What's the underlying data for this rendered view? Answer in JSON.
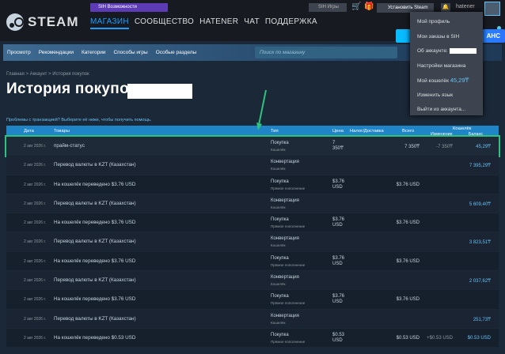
{
  "header": {
    "logo_text": "STEAM",
    "sih_badge": "SIH Возможности",
    "nav": [
      "МАГАЗИН",
      "СООБЩЕСТВО",
      "HATENER",
      "ЧАТ",
      "ПОДДЕРЖКА"
    ],
    "sih_games": "SIH Игры",
    "install_label": "Установить Steam",
    "username": "hatener",
    "promo_label": "АНС"
  },
  "dropdown": {
    "items": [
      "Мой профиль",
      "Мои заказы в SIH",
      "Об аккаунте:",
      "Настройки магазина"
    ],
    "wallet_label": "Мой кошелёк",
    "wallet_amount": "45,29₸",
    "language": "Изменить язык",
    "logout": "Выйти из аккаунта..."
  },
  "subnav": {
    "items": [
      "Просмотр",
      "Рекомендации",
      "Категории",
      "Способы игры",
      "Особые разделы"
    ],
    "search_placeholder": "Поиск по магазину"
  },
  "breadcrumb": "Главная > Аккаунт > История покупок",
  "page_title": "История покупок",
  "help_text": "Проблемы с транзакцией? Выберите её ниже, чтобы получить помощь.",
  "table": {
    "headers": {
      "date": "Дата",
      "items": "Товары",
      "type": "Тип",
      "price": "Цена",
      "tax": "Налог/Доставка",
      "total": "Всего",
      "wallet": "Кошелёк",
      "change": "Изменение",
      "balance": "Баланс"
    },
    "rows": [
      {
        "date": "2 авг 2026 г.",
        "items": "прайм-статус",
        "type": "Покупка",
        "sub": "Кошелёк",
        "price1": "7",
        "price2": "350₸",
        "total": "7 350₸",
        "change": "-7 350₸",
        "balance": "45,29₸"
      },
      {
        "date": "2 авг 2026 г.",
        "items": "Перевод валюты в KZT (Казахстан)",
        "type": "Конвертация",
        "sub": "Кошелёк",
        "price1": "",
        "price2": "",
        "total": "",
        "change": "",
        "balance": "7 395,29₸"
      },
      {
        "date": "2 авг 2026 г.",
        "items": "На кошелёк переведено $3.76 USD",
        "type": "Покупка",
        "sub": "Прямое пополнение",
        "price1": "$3.76",
        "price2": "USD",
        "total": "$3.76 USD",
        "change": "",
        "balance": ""
      },
      {
        "date": "2 авг 2026 г.",
        "items": "Перевод валюты в KZT (Казахстан)",
        "type": "Конвертация",
        "sub": "Кошелёк",
        "price1": "",
        "price2": "",
        "total": "",
        "change": "",
        "balance": "5 609,40₸"
      },
      {
        "date": "2 авг 2026 г.",
        "items": "На кошелёк переведено $3.76 USD",
        "type": "Покупка",
        "sub": "Прямое пополнение",
        "price1": "$3.76",
        "price2": "USD",
        "total": "$3.76 USD",
        "change": "",
        "balance": ""
      },
      {
        "date": "2 авг 2026 г.",
        "items": "Перевод валюты в KZT (Казахстан)",
        "type": "Конвертация",
        "sub": "Кошелёк",
        "price1": "",
        "price2": "",
        "total": "",
        "change": "",
        "balance": "3 823,51₸"
      },
      {
        "date": "2 авг 2026 г.",
        "items": "На кошелёк переведено $3.76 USD",
        "type": "Покупка",
        "sub": "Прямое пополнение",
        "price1": "$3.76",
        "price2": "USD",
        "total": "$3.76 USD",
        "change": "",
        "balance": ""
      },
      {
        "date": "2 авг 2026 г.",
        "items": "Перевод валюты в KZT (Казахстан)",
        "type": "Конвертация",
        "sub": "Кошелёк",
        "price1": "",
        "price2": "",
        "total": "",
        "change": "",
        "balance": "2 037,62₸"
      },
      {
        "date": "2 авг 2026 г.",
        "items": "На кошелёк переведено $3.76 USD",
        "type": "Покупка",
        "sub": "Прямое пополнение",
        "price1": "$3.76",
        "price2": "USD",
        "total": "$3.76 USD",
        "change": "",
        "balance": ""
      },
      {
        "date": "2 авг 2026 г.",
        "items": "Перевод валюты в KZT (Казахстан)",
        "type": "Конвертация",
        "sub": "Кошелёк",
        "price1": "",
        "price2": "",
        "total": "",
        "change": "",
        "balance": "251,73₸"
      },
      {
        "date": "2 авг 2026 г.",
        "items": "На кошелёк переведено $0.53 USD",
        "type": "Покупка",
        "sub": "Прямое пополнение",
        "price1": "$0.53",
        "price2": "USD",
        "total": "$0.53 USD",
        "change": "+$0.53 USD",
        "balance": "$0.53 USD"
      }
    ]
  },
  "colors": {
    "accent": "#1a9fff",
    "highlight": "#2ec27e",
    "header_row": "#1f85c7"
  }
}
